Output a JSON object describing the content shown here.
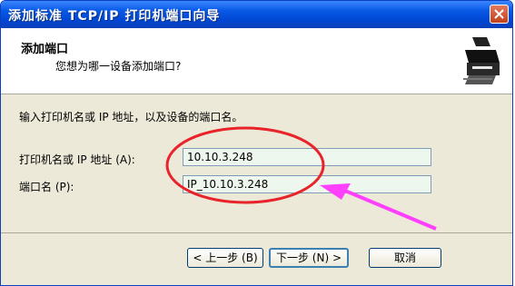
{
  "window": {
    "title": "添加标准 TCP/IP 打印机端口向导"
  },
  "header": {
    "title": "添加端口",
    "subtitle": "您想为哪一设备添加端口?"
  },
  "content": {
    "instruction": "输入打印机名或 IP 地址，以及设备的端口名。",
    "fields": [
      {
        "label": "打印机名或 IP 地址 (A):",
        "value": "10.10.3.248"
      },
      {
        "label": "端口名 (P):",
        "value": "IP_10.10.3.248"
      }
    ]
  },
  "buttons": {
    "back": "< 上一步 (B)",
    "next": "下一步 (N) >",
    "cancel": "取消"
  },
  "icons": {
    "close": "close-icon",
    "printer": "printer-icon"
  },
  "annotation": {
    "ellipse_color": "#e8232a",
    "arrow_color": "#ff40ff"
  }
}
